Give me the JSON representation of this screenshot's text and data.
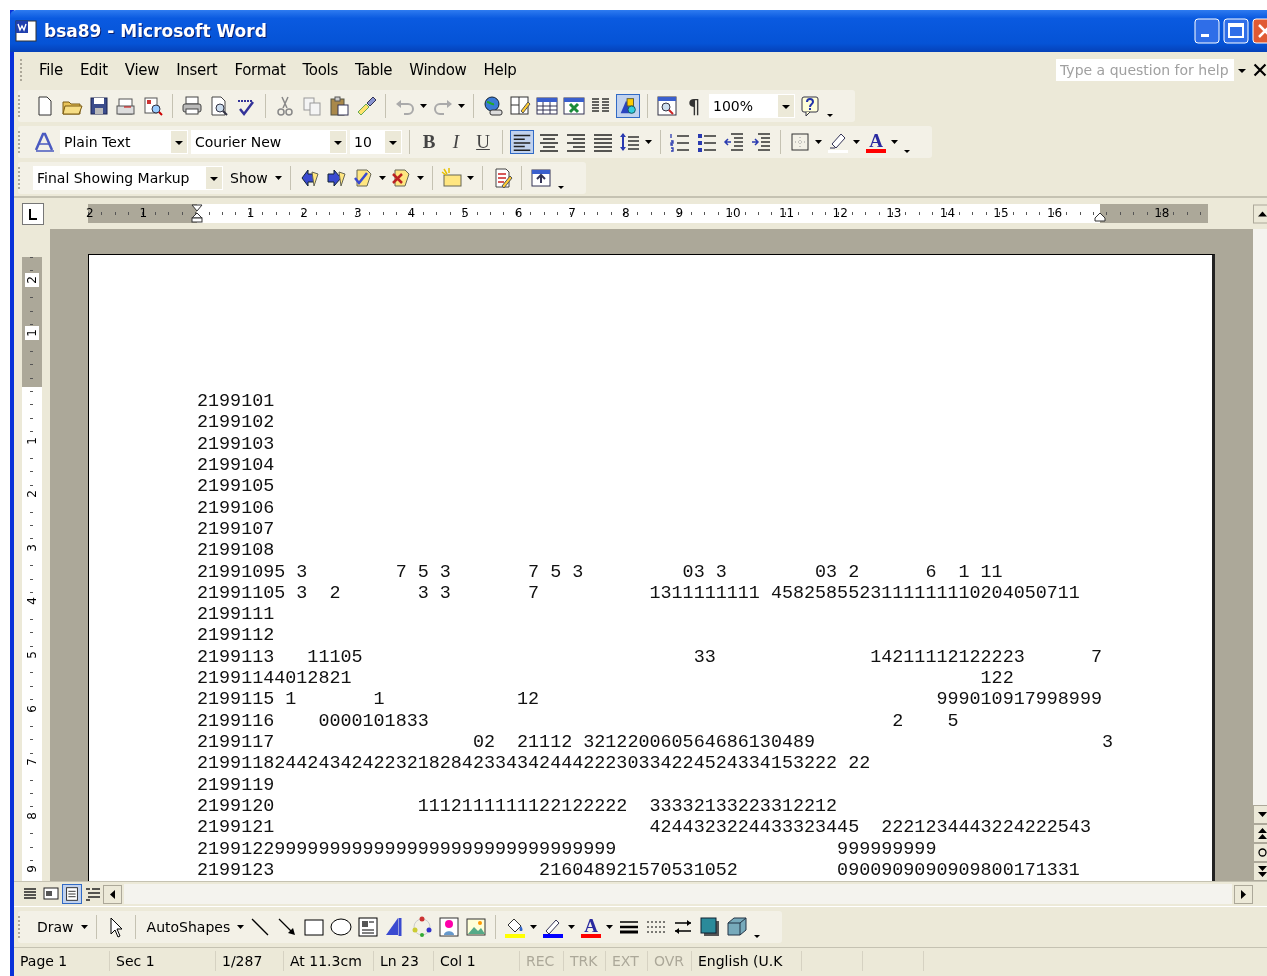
{
  "window": {
    "title": "bsa89 - Microsoft Word"
  },
  "menu": [
    "File",
    "Edit",
    "View",
    "Insert",
    "Format",
    "Tools",
    "Table",
    "Window",
    "Help"
  ],
  "help_box": {
    "placeholder": "Type a question for help"
  },
  "standard_toolbar": {
    "drawing_button": {
      "pressed": true
    },
    "show_hide_label": "¶",
    "zoom": "100%"
  },
  "formatting_toolbar": {
    "style": "Plain Text",
    "font": "Courier New",
    "size": "10",
    "bold_label": "B",
    "italic_label": "I",
    "underline_label": "U",
    "alignment": [
      {
        "kind": "left",
        "selected": true
      },
      {
        "kind": "center",
        "selected": false
      },
      {
        "kind": "right",
        "selected": false
      },
      {
        "kind": "justify",
        "selected": false
      }
    ],
    "font_color_label": "A"
  },
  "reviewing_toolbar": {
    "display": "Final Showing Markup",
    "show": "Show"
  },
  "horizontal_ruler": {
    "left_labels": [
      "2",
      "1"
    ],
    "labels": [
      "1",
      "2",
      "3",
      "4",
      "5",
      "6",
      "7",
      "8",
      "9",
      "10",
      "11",
      "12",
      "13",
      "14",
      "15",
      "16"
    ],
    "right_labels": [
      "18"
    ]
  },
  "vertical_ruler": {
    "top_labels": [
      "2",
      "1"
    ],
    "labels": [
      "1",
      "2",
      "3",
      "4",
      "5",
      "6",
      "7",
      "8",
      "9"
    ]
  },
  "document": {
    "lines": [
      "2199101",
      "2199102",
      "2199103",
      "2199104",
      "2199105",
      "2199106",
      "2199107",
      "2199108",
      "21991095 3        7 5 3       7 5 3         03 3        03 2      6  1 11",
      "21991105 3  2       3 3       7          1311111111 4582585523111111110204050711",
      "2199111",
      "2199112",
      "2199113   11105                              33              14211112122223      7",
      "21991144012821                                                         122",
      "2199115 1       1            12                                    999010917998999",
      "2199116    0000101833                                          2    5",
      "2199117                  02  21112 321220060564686130489                          3",
      "2199118244243424223218284233434244422230334224524334153222 22",
      "2199119",
      "2199120             1112111111122122222  33332133223312212",
      "2199121                                  4244323224433323445  2221234443224222543",
      "21991229999999999999999999999999999999                    999999999",
      "2199123                        216048921570531052         0900909090909800171331"
    ]
  },
  "view_buttons": [
    {
      "kind": "normal",
      "selected": false
    },
    {
      "kind": "web",
      "selected": false
    },
    {
      "kind": "print",
      "selected": true
    },
    {
      "kind": "outline",
      "selected": false
    }
  ],
  "drawing_toolbar": {
    "draw": "Draw",
    "autoshapes": "AutoShapes",
    "font_color_label": "A"
  },
  "status_bar": {
    "fields": [
      {
        "text": "Page 1",
        "disabled": false
      },
      {
        "text": "Sec 1",
        "disabled": false
      },
      {
        "text": "1/287",
        "disabled": false
      },
      {
        "text": "At 11.3cm",
        "disabled": false
      },
      {
        "text": "Ln 23",
        "disabled": false
      },
      {
        "text": "Col 1",
        "disabled": false
      },
      {
        "text": "REC",
        "disabled": true
      },
      {
        "text": "TRK",
        "disabled": true
      },
      {
        "text": "EXT",
        "disabled": true
      },
      {
        "text": "OVR",
        "disabled": true
      },
      {
        "text": "English (U.K",
        "disabled": false
      }
    ]
  }
}
